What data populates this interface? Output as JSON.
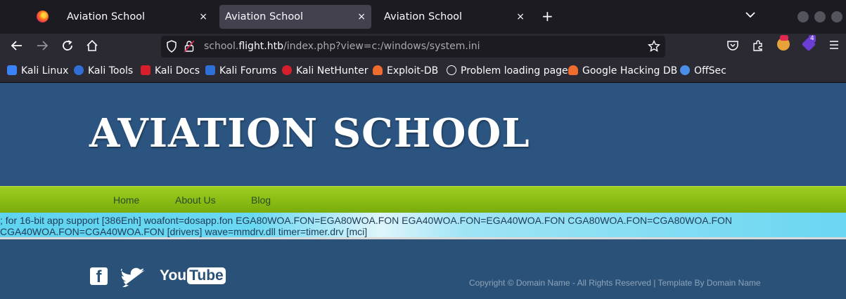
{
  "browser": {
    "tabs": [
      {
        "title": "Aviation School",
        "close": "×"
      },
      {
        "title": "Aviation School",
        "close": "×"
      },
      {
        "title": "Aviation School",
        "close": "×"
      }
    ],
    "new_tab": "+",
    "url_prefix": "school.",
    "url_host": "flight.htb",
    "url_path": "/index.php?view=c:/windows/system.ini",
    "extensions_badge": "4",
    "bookmarks": [
      {
        "label": "Kali Linux",
        "color": "#3b82f6"
      },
      {
        "label": "Kali Tools",
        "color": "#2f6fd6"
      },
      {
        "label": "Kali Docs",
        "color": "#d61f2c"
      },
      {
        "label": "Kali Forums",
        "color": "#2f6fd6"
      },
      {
        "label": "Kali NetHunter",
        "color": "#d61f2c"
      },
      {
        "label": "Exploit-DB",
        "color": "#ef6c2f"
      },
      {
        "label": "Problem loading page",
        "color": "#fbfbfe"
      },
      {
        "label": "Google Hacking DB",
        "color": "#ef6c2f"
      },
      {
        "label": "OffSec",
        "color": "#4a8fe7"
      }
    ]
  },
  "site": {
    "title": "AVIATION SCHOOL",
    "menu": [
      "Home",
      "About Us",
      "Blog"
    ],
    "include_output": "; for 16-bit app support [386Enh] woafont=dosapp.fon EGA80WOA.FON=EGA80WOA.FON EGA40WOA.FON=EGA40WOA.FON CGA80WOA.FON=CGA80WOA.FON CGA40WOA.FON=CGA40WOA.FON [drivers] wave=mmdrv.dll timer=timer.drv [mci]",
    "social": {
      "facebook": "f",
      "twitter": "🐦",
      "youtube_you": "You",
      "youtube_tube": "Tube"
    },
    "copyright": "Copyright © Domain Name - All Rights Reserved | Template By Domain Name"
  }
}
